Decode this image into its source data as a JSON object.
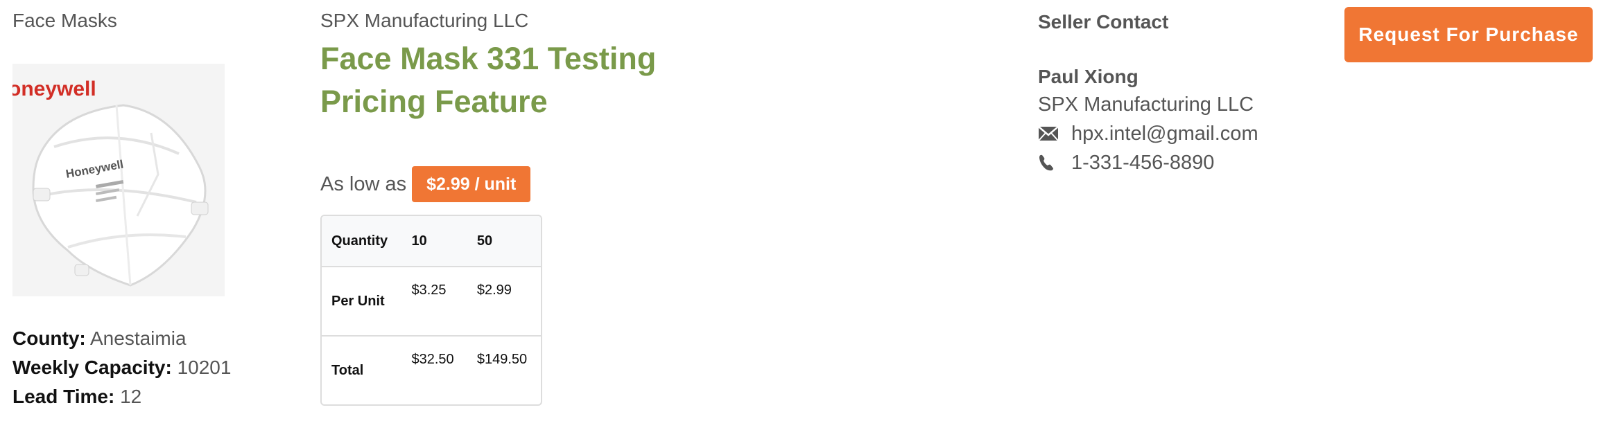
{
  "product": {
    "category": "Face Masks",
    "image_brand_text": "oneywell",
    "image_mask_text": "Honeywell",
    "specs": [
      {
        "label": "County:",
        "value": "Anestaimia"
      },
      {
        "label": "Weekly Capacity:",
        "value": "10201"
      },
      {
        "label": "Lead Time:",
        "value": "12"
      }
    ]
  },
  "listing": {
    "seller": "SPX Manufacturing LLC",
    "title": "Face Mask 331 Testing Pricing Feature",
    "as_low_as_label": "As low as",
    "price_badge": "$2.99 / unit"
  },
  "pricing_table": {
    "header": {
      "label": "Quantity",
      "cols": [
        "10",
        "50"
      ]
    },
    "rows": [
      {
        "label": "Per Unit",
        "values": [
          "$3.25",
          "$2.99"
        ]
      },
      {
        "label": "Total",
        "values": [
          "$32.50",
          "$149.50"
        ]
      }
    ]
  },
  "contact": {
    "heading": "Seller Contact",
    "name": "Paul Xiong",
    "company": "SPX Manufacturing LLC",
    "email": "hpx.intel@gmail.com",
    "phone": "1-331-456-8890",
    "email_icon": "envelope-icon",
    "phone_icon": "phone-icon"
  },
  "actions": {
    "request_button": "Request For Purchase"
  },
  "colors": {
    "accent_orange": "#f07634",
    "title_green": "#7a9a4a",
    "text_gray": "#555555"
  }
}
